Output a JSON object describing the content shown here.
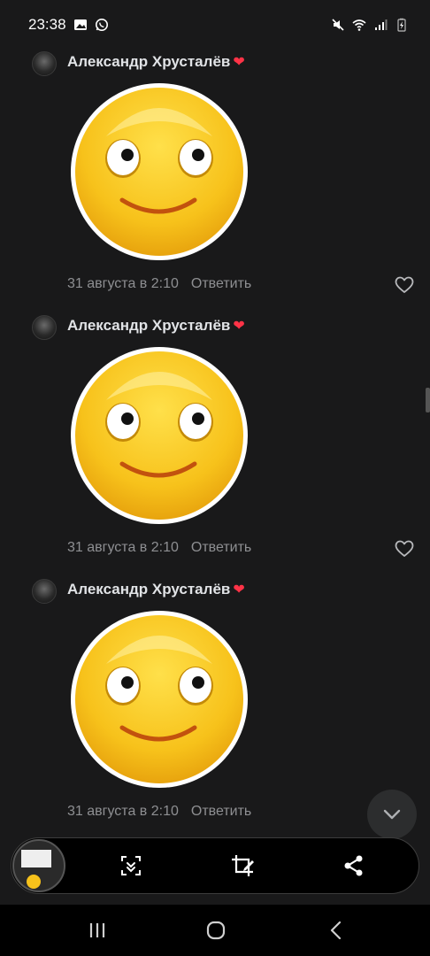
{
  "status_bar": {
    "time": "23:38",
    "left_icons": [
      "image-icon",
      "whatsapp-icon"
    ],
    "right_icons": [
      "mute-icon",
      "wifi-icon",
      "signal-icon",
      "battery-charging-icon"
    ]
  },
  "comments": [
    {
      "author": "Александр Хрусталёв",
      "author_badge": "❤",
      "sticker": "smiley-face-sticker",
      "date": "31 августа в 2:10",
      "reply_label": "Ответить",
      "like_icon": "heart-outline-icon"
    },
    {
      "author": "Александр Хрусталёв",
      "author_badge": "❤",
      "sticker": "smiley-face-sticker",
      "date": "31 августа в 2:10",
      "reply_label": "Ответить",
      "like_icon": "heart-outline-icon"
    },
    {
      "author": "Александр Хрусталёв",
      "author_badge": "❤",
      "sticker": "smiley-face-sticker",
      "date": "31 августа в 2:10",
      "reply_label": "Ответить"
    }
  ],
  "scroll_down_icon": "chevron-down-icon",
  "capture_toolbar": {
    "thumbnail": "screenshot-thumbnail",
    "buttons": [
      "scroll-capture-icon",
      "crop-edit-icon",
      "share-icon"
    ]
  },
  "nav_bar": {
    "buttons": [
      "recent-apps-icon",
      "home-icon",
      "back-icon"
    ]
  },
  "colors": {
    "background": "#19191a",
    "text_primary": "#e1e3e6",
    "text_secondary": "#8e8f92",
    "badge_heart": "#ff3347",
    "sticker_yellow": "#f7c21b"
  }
}
